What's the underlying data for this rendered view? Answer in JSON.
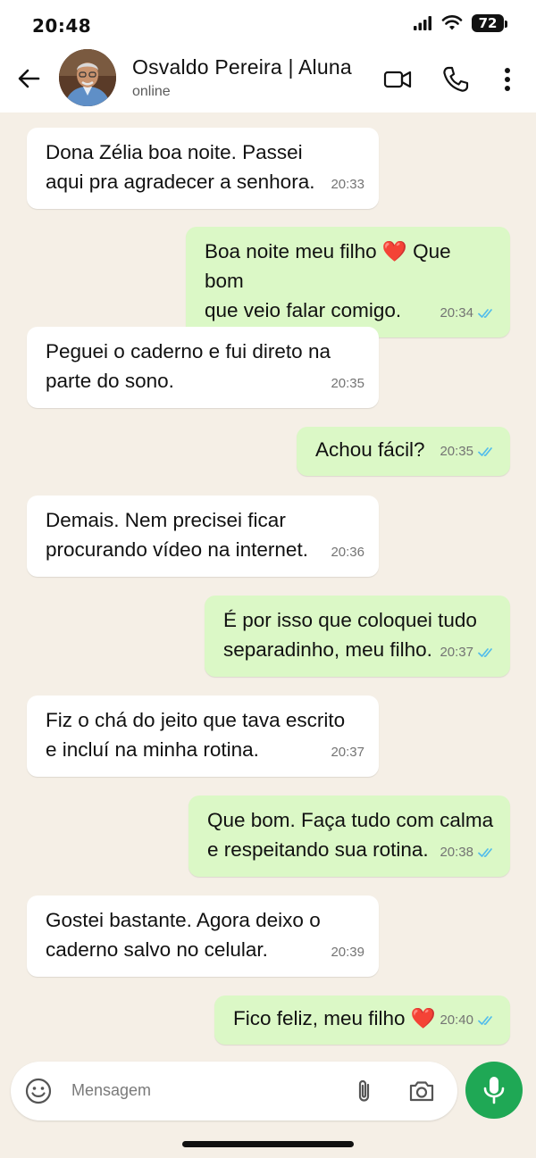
{
  "status_bar": {
    "time": "20:48",
    "battery": "72"
  },
  "header": {
    "contact_name": "Osvaldo Pereira | Aluna",
    "contact_status": "online"
  },
  "messages": [
    {
      "direction": "incoming",
      "lines": [
        "Dona Zélia boa noite. Passei",
        "aqui pra agradecer a senhora."
      ],
      "time": "20:33"
    },
    {
      "direction": "outgoing",
      "lines": [
        "Boa noite meu filho ❤️ Que bom",
        "que veio falar comigo."
      ],
      "time": "20:34",
      "read": true
    },
    {
      "direction": "incoming",
      "lines": [
        "Peguei o caderno e fui direto na",
        "parte do sono."
      ],
      "time": "20:35"
    },
    {
      "direction": "outgoing",
      "lines": [
        "Achou fácil?"
      ],
      "time": "20:35",
      "read": true
    },
    {
      "direction": "incoming",
      "lines": [
        "Demais. Nem precisei ficar",
        "procurando vídeo na internet."
      ],
      "time": "20:36"
    },
    {
      "direction": "outgoing",
      "lines": [
        "É por isso que coloquei tudo",
        "separadinho, meu filho."
      ],
      "time": "20:37",
      "read": true
    },
    {
      "direction": "incoming",
      "lines": [
        "Fiz o chá do jeito que tava escrito",
        "e incluí na minha rotina."
      ],
      "time": "20:37"
    },
    {
      "direction": "outgoing",
      "lines": [
        "Que bom. Faça tudo com calma",
        "e respeitando sua rotina."
      ],
      "time": "20:38",
      "read": true
    },
    {
      "direction": "incoming",
      "lines": [
        "Gostei bastante. Agora deixo o",
        "caderno salvo no celular."
      ],
      "time": "20:39"
    },
    {
      "direction": "outgoing",
      "lines": [
        "Fico feliz, meu filho ❤️"
      ],
      "time": "20:40",
      "read": true
    }
  ],
  "composer": {
    "placeholder": "Mensagem"
  },
  "colors": {
    "incoming_bubble": "#ffffff",
    "outgoing_bubble": "#dbf8c6",
    "read_ticks": "#53bdeb",
    "mic_button": "#1fa855",
    "chat_background": "#f5efe6"
  },
  "icons": [
    "back-arrow-icon",
    "video-call-icon",
    "phone-icon",
    "more-options-icon",
    "emoji-icon",
    "attach-icon",
    "camera-icon",
    "mic-icon",
    "signal-icon",
    "wifi-icon"
  ]
}
